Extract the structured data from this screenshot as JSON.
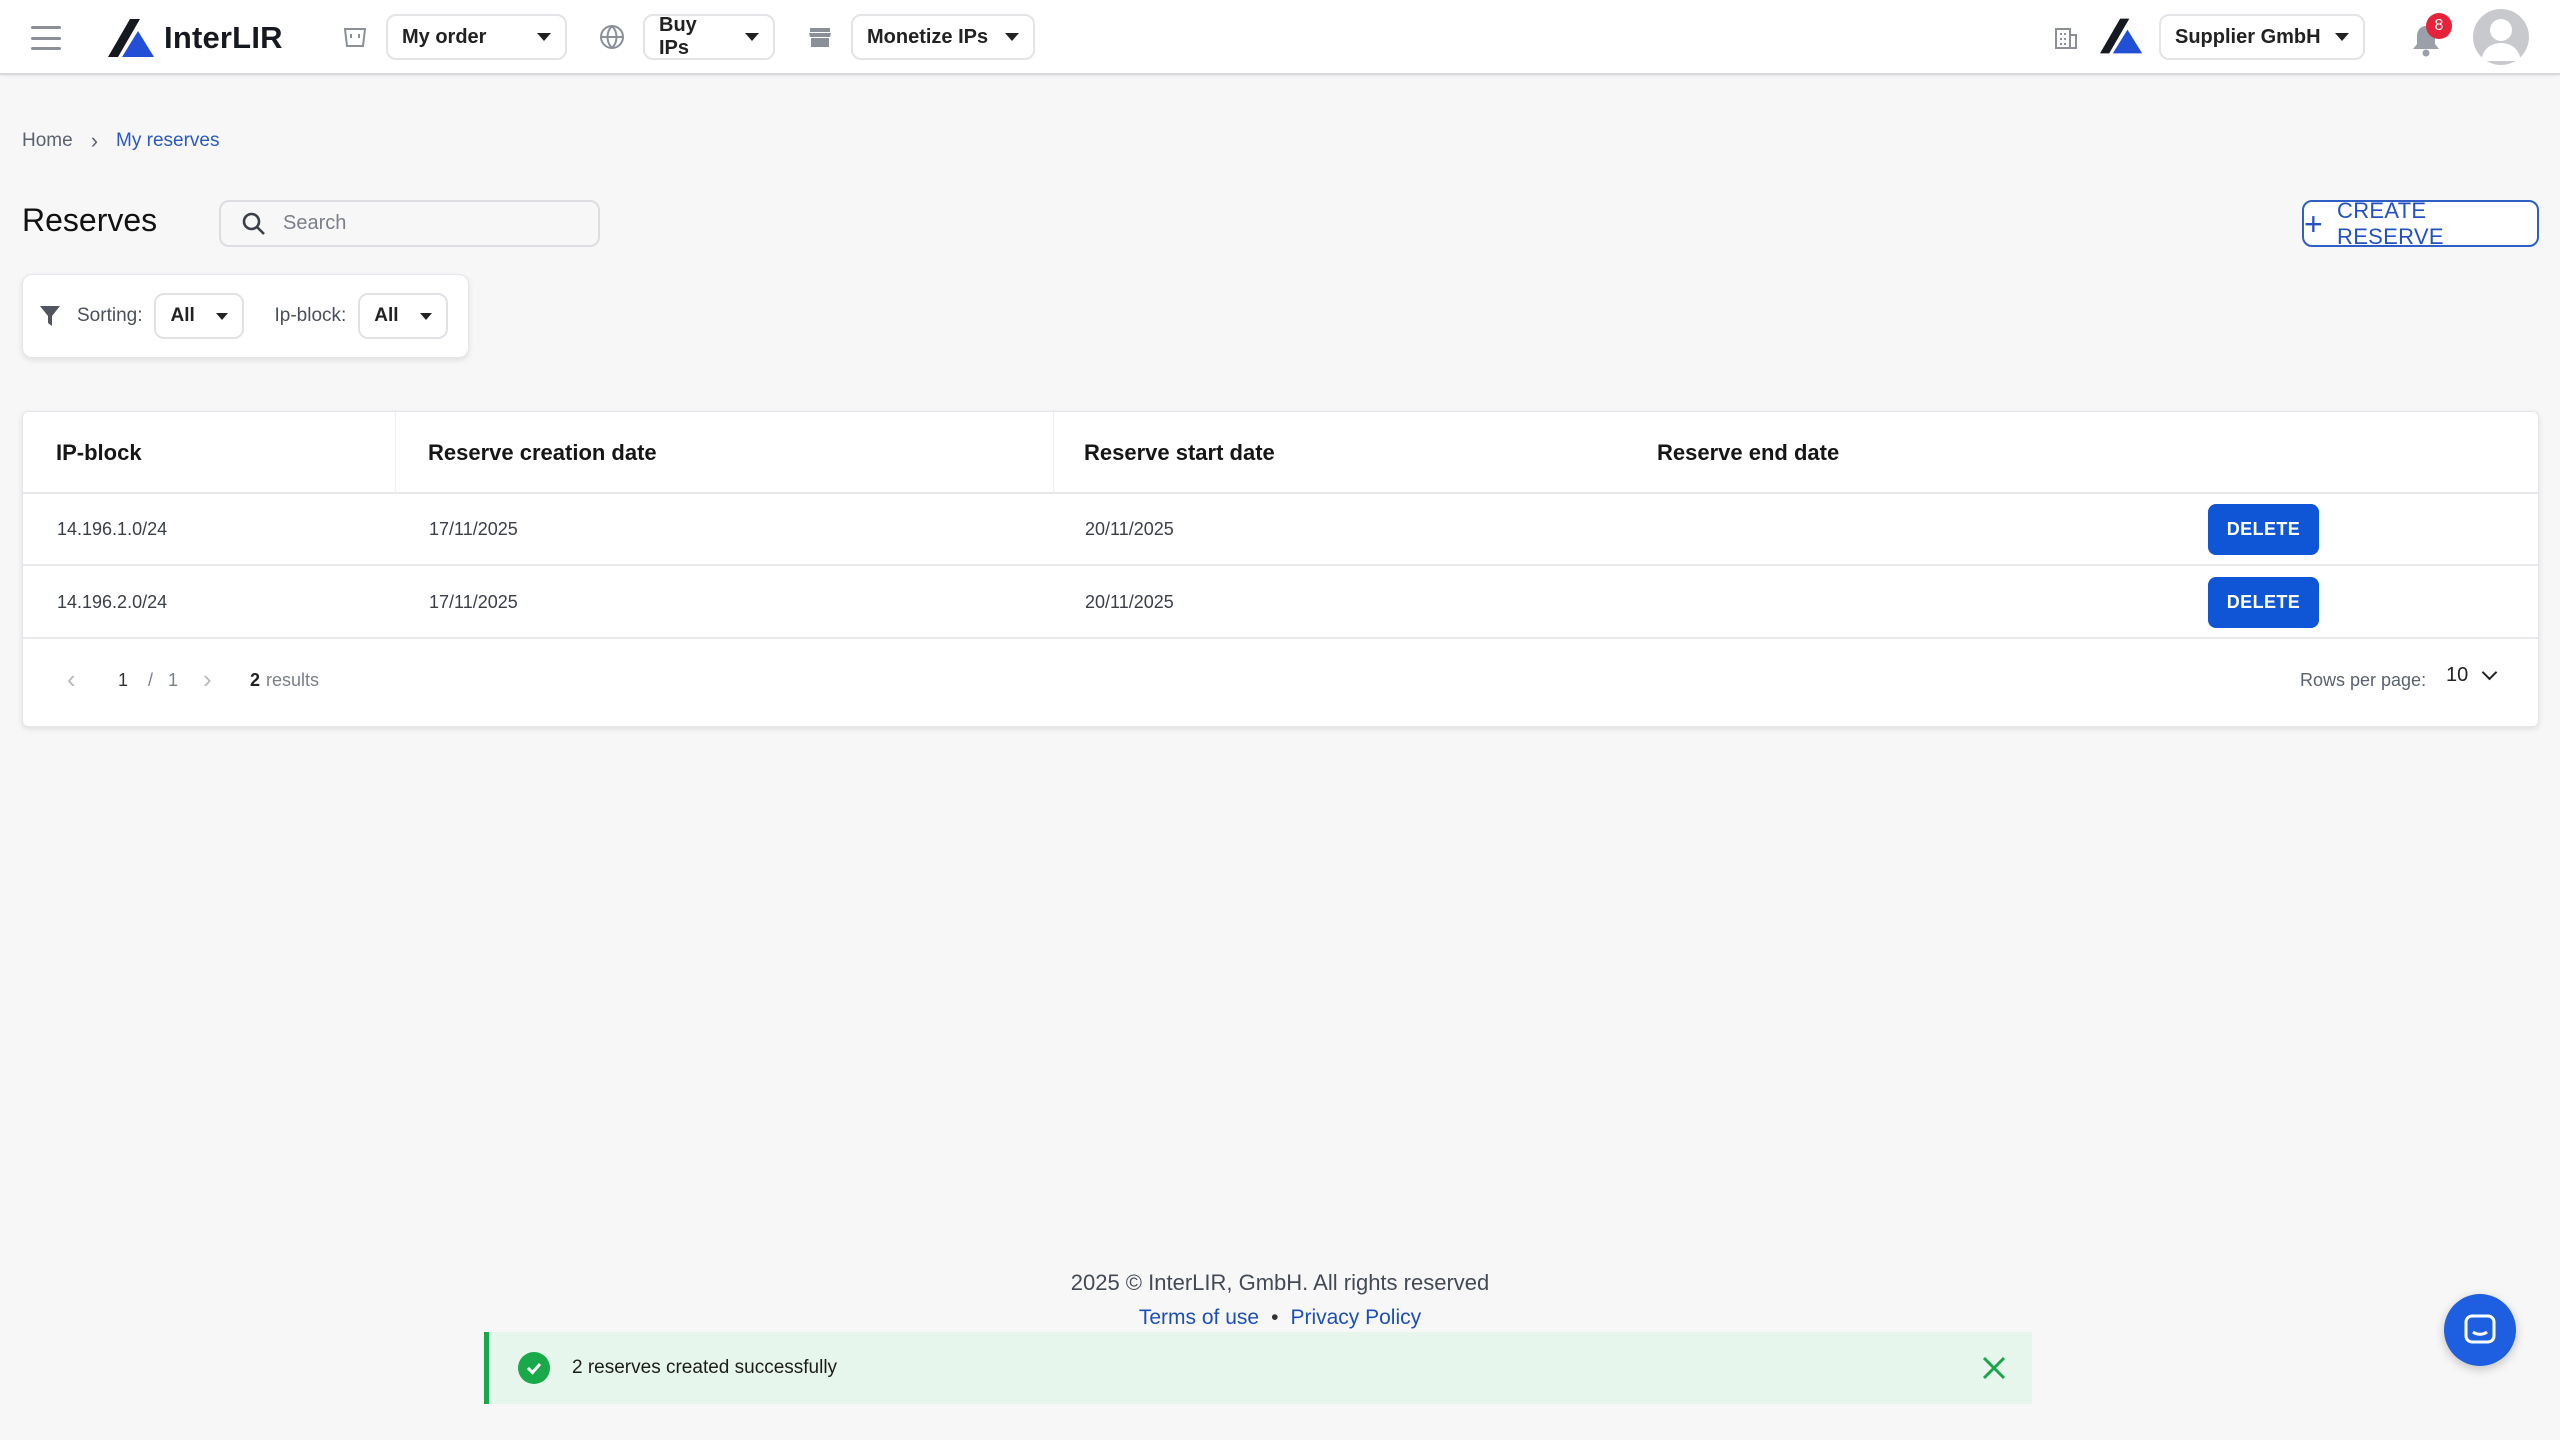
{
  "topbar": {
    "logo_text": "InterLIR",
    "my_order_label": "My order",
    "buy_ips_label": "Buy IPs",
    "monetize_ips_label": "Monetize IPs",
    "company_label": "Supplier GmbH",
    "notification_count": "8"
  },
  "breadcrumb": {
    "home": "Home",
    "current": "My reserves"
  },
  "page": {
    "title": "Reserves",
    "search_placeholder": "Search",
    "create_button_label": "CREATE RESERVE"
  },
  "filters": {
    "sorting_label": "Sorting:",
    "sorting_value": "All",
    "ipblock_label": "Ip-block:",
    "ipblock_value": "All"
  },
  "table": {
    "columns": [
      "IP-block",
      "Reserve creation date",
      "Reserve start date",
      "Reserve end date"
    ],
    "rows": [
      {
        "ip_block": "14.196.1.0/24",
        "creation_date": "17/11/2025",
        "start_date": "20/11/2025",
        "end_date": "",
        "action": "DELETE"
      },
      {
        "ip_block": "14.196.2.0/24",
        "creation_date": "17/11/2025",
        "start_date": "20/11/2025",
        "end_date": "",
        "action": "DELETE"
      }
    ]
  },
  "pagination": {
    "current_page": "1",
    "separator": "/",
    "total_pages": "1",
    "results_count": "2",
    "results_label": "results",
    "rows_per_page_label": "Rows per page:",
    "rows_per_page_value": "10"
  },
  "footer": {
    "copyright": "2025 © InterLIR, GmbH. All rights reserved",
    "terms": "Terms of use",
    "privacy": "Privacy Policy"
  },
  "toast": {
    "message": "2 reserves created successfully",
    "status_color": "#1aa64a"
  },
  "colors": {
    "accent": "#0f56d6",
    "link": "#2b58c4",
    "badge": "#e5243b"
  }
}
